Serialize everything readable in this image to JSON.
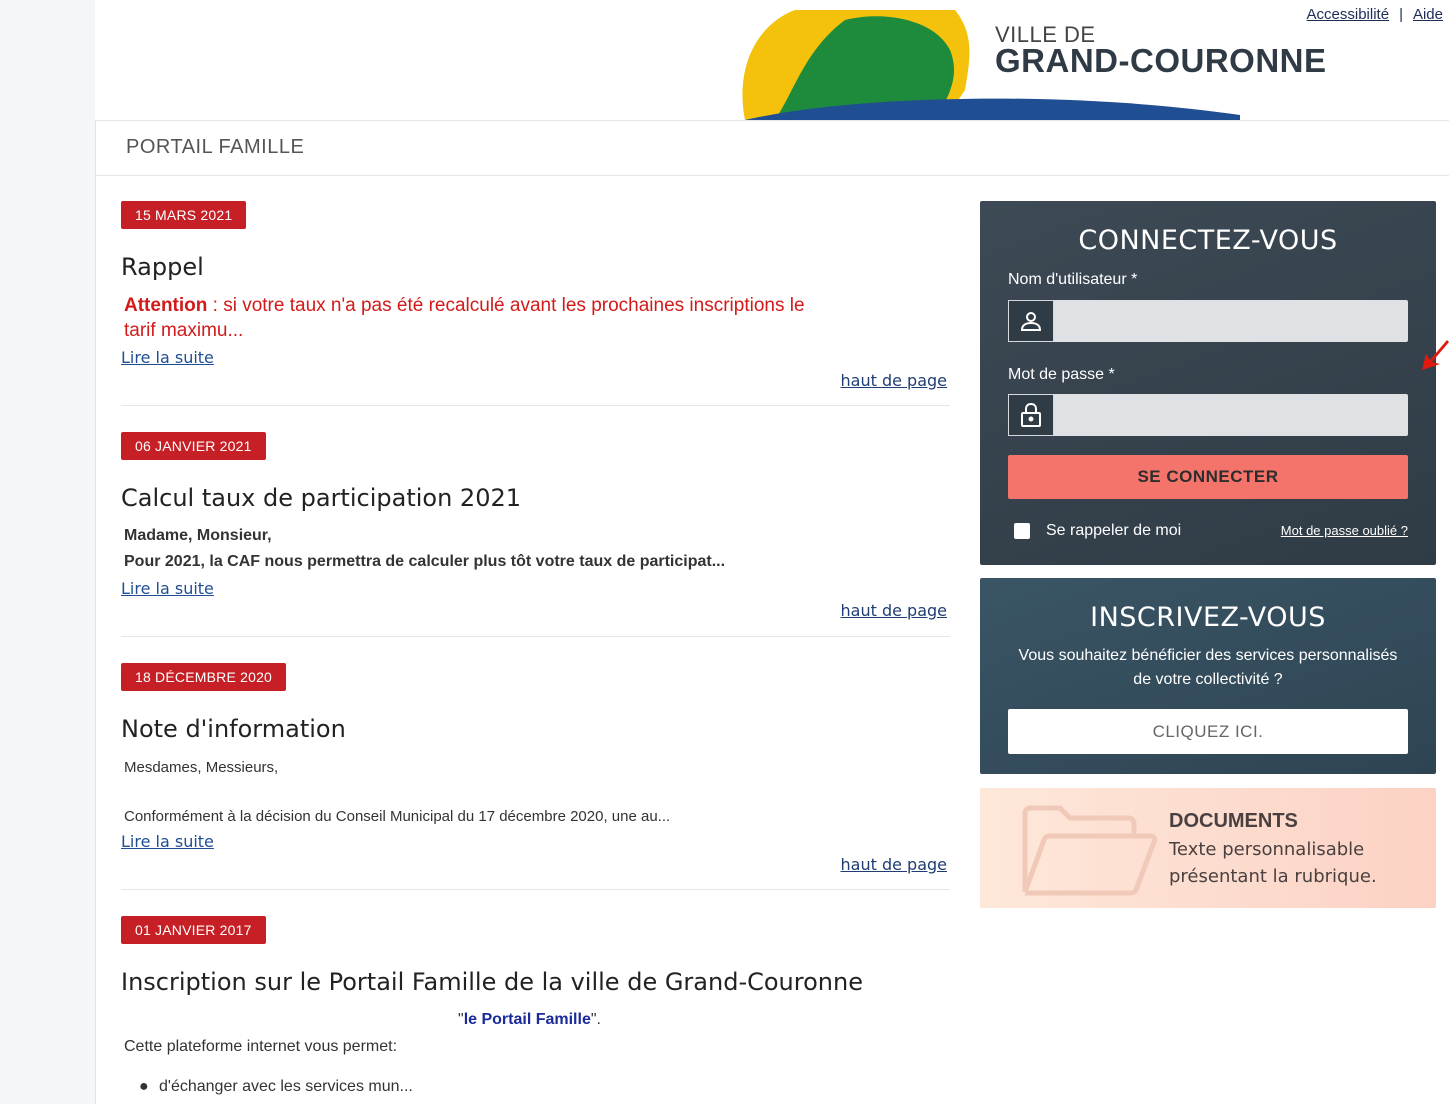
{
  "header": {
    "ville_de": "VILLE DE",
    "city_name": "GRAND-COURONNE",
    "links": {
      "accessibility": "Accessibilité",
      "separator": "|",
      "help": "Aide"
    }
  },
  "portal": {
    "title": "PORTAIL FAMILLE"
  },
  "news": [
    {
      "date": "15 MARS 2021",
      "title": "Rappel",
      "body_strong": "Attention",
      "body_line1": " : si votre taux n'a pas été recalculé avant les prochaines inscriptions le",
      "body_line2": "tarif maximu...",
      "read_more": "Lire la suite",
      "top": "haut de page"
    },
    {
      "date": "06 JANVIER 2021",
      "title": "Calcul taux de participation 2021",
      "body_line1": "Madame, Monsieur,",
      "body_line2": "Pour 2021, la CAF nous permettra de calculer plus tôt votre taux de participat...",
      "read_more": "Lire la suite",
      "top": "haut de page"
    },
    {
      "date": "18 DÉCEMBRE 2020",
      "title": "Note d'information",
      "body_line1": "Mesdames, Messieurs,",
      "body_line2": "Conformément à la décision du Conseil Municipal du 17 décembre 2020, une au...",
      "read_more": "Lire la suite",
      "top": "haut de page"
    },
    {
      "date": "01 JANVIER 2017",
      "title": "Inscription sur le Portail Famille de la ville de Grand-Couronne",
      "quote_open": "\"",
      "quote_link": "le Portail Famille",
      "quote_close": "\".",
      "body_line1": "Cette plateforme internet vous permet:",
      "bullet": "d'échanger avec les services mun..."
    }
  ],
  "login": {
    "title": "CONNECTEZ-VOUS",
    "username_label": "Nom d'utilisateur *",
    "username_value": "",
    "password_label": "Mot de passe *",
    "password_value": "",
    "submit": "SE CONNECTER",
    "remember": "Se rappeler de moi",
    "forgot": "Mot de passe oublié ?"
  },
  "signup": {
    "title": "INSCRIVEZ-VOUS",
    "text": "Vous souhaitez bénéficier des services personnalisés de votre collectivité ?",
    "button": "CLIQUEZ ICI."
  },
  "documents": {
    "title": "DOCUMENTS",
    "text_line1": "Texte personnalisable",
    "text_line2": "présentant la rubrique."
  },
  "colors": {
    "badge_red": "#c62026",
    "login_bg": "#36434e",
    "signup_bg": "#344c5b",
    "connect_btn": "#f4736a",
    "docs_bg": "#fcdccd"
  }
}
